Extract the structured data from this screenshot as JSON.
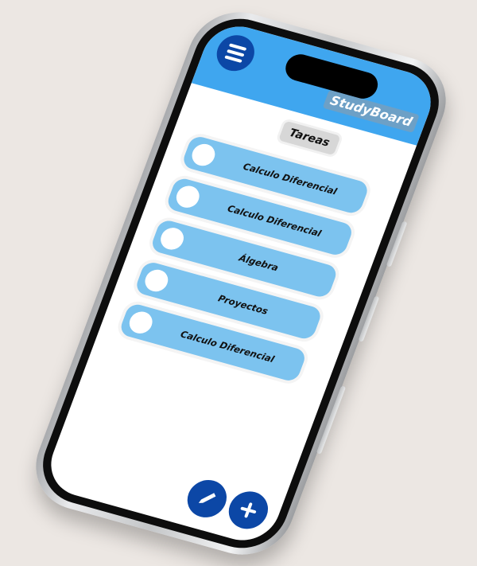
{
  "app": {
    "brand": "StudyBoard"
  },
  "page": {
    "title": "Tareas"
  },
  "tasks": [
    {
      "label": "Calculo Diferencial"
    },
    {
      "label": "Calculo Diferencial"
    },
    {
      "label": "Álgebra"
    },
    {
      "label": "Proyectos"
    },
    {
      "label": "Calculo Diferencial"
    }
  ],
  "icons": {
    "menu": "hamburger-menu-icon",
    "edit": "pencil-icon",
    "add": "plus-icon"
  },
  "colors": {
    "header": "#3fa6ef",
    "task": "#7cc3ef",
    "accent": "#0c47a6",
    "background": "#ece7e3"
  }
}
